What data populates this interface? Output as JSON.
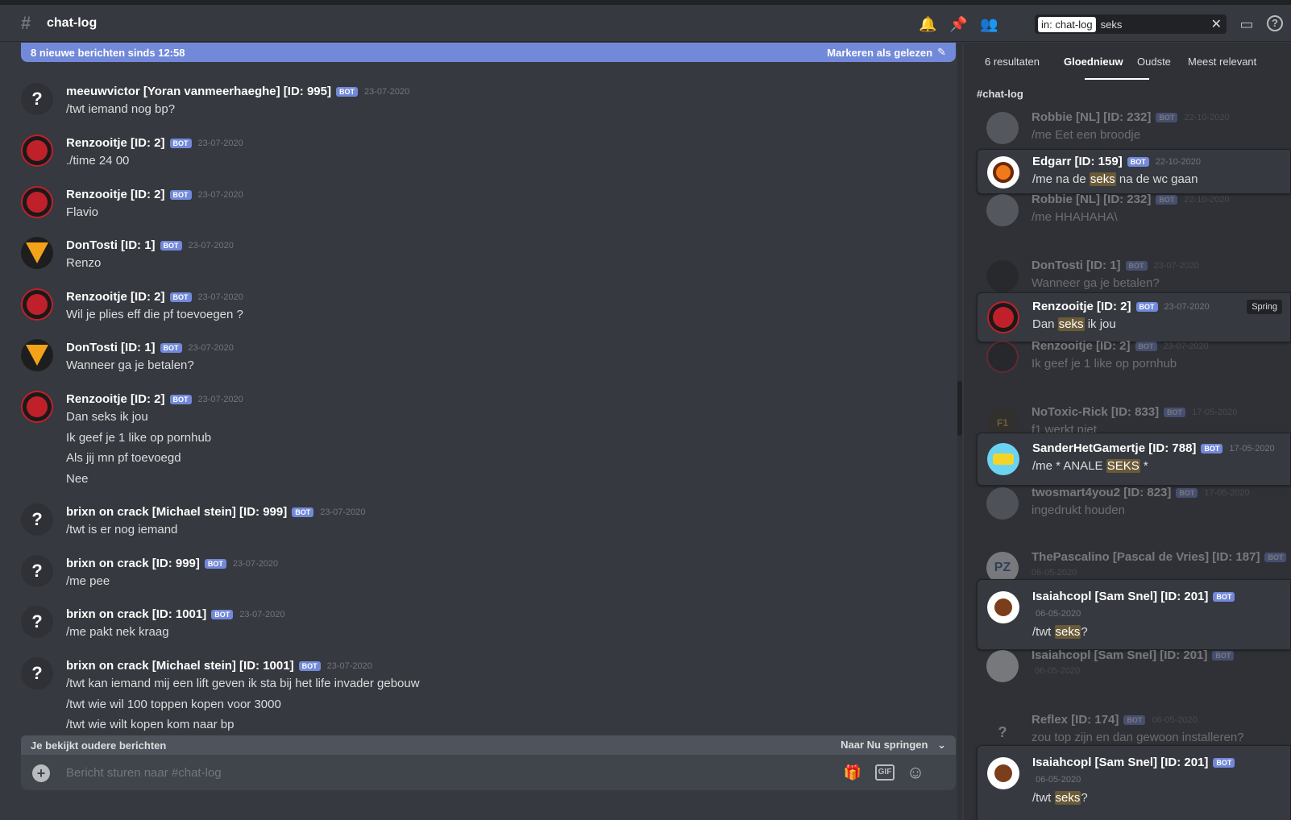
{
  "header": {
    "channel_name": "chat-log",
    "search_filter": "in: chat-log",
    "search_query": "seks"
  },
  "newbar": {
    "text": "8 nieuwe berichten sinds 12:58",
    "mark_read": "Markeren als gelezen"
  },
  "messages": [
    {
      "author": "meeuwvictor [Yoran vanmeerhaeghe] [ID: 995]",
      "badge": "BOT",
      "time": "23-07-2020",
      "lines": [
        "/twt iemand nog bp?"
      ]
    },
    {
      "author": "Renzooitje [ID: 2]",
      "badge": "BOT",
      "time": "23-07-2020",
      "lines": [
        "./time 24 00"
      ]
    },
    {
      "author": "Renzooitje [ID: 2]",
      "badge": "BOT",
      "time": "23-07-2020",
      "lines": [
        "Flavio"
      ]
    },
    {
      "author": "DonTosti [ID: 1]",
      "badge": "BOT",
      "time": "23-07-2020",
      "lines": [
        "Renzo"
      ]
    },
    {
      "author": "Renzooitje [ID: 2]",
      "badge": "BOT",
      "time": "23-07-2020",
      "lines": [
        "Wil je plies eff die pf toevoegen ?"
      ]
    },
    {
      "author": "DonTosti [ID: 1]",
      "badge": "BOT",
      "time": "23-07-2020",
      "lines": [
        "Wanneer ga je betalen?"
      ]
    },
    {
      "author": "Renzooitje [ID: 2]",
      "badge": "BOT",
      "time": "23-07-2020",
      "lines": [
        "Dan seks ik jou",
        "Ik geef je 1 like op pornhub",
        "Als jij mn pf toevoegd",
        "Nee"
      ]
    },
    {
      "author": "brixn on crack [Michael stein] [ID: 999]",
      "badge": "BOT",
      "time": "23-07-2020",
      "lines": [
        "/twt is er nog iemand"
      ]
    },
    {
      "author": "brixn on crack [ID: 999]",
      "badge": "BOT",
      "time": "23-07-2020",
      "lines": [
        "/me pee"
      ]
    },
    {
      "author": "brixn on crack [ID: 1001]",
      "badge": "BOT",
      "time": "23-07-2020",
      "lines": [
        "/me pakt nek kraag"
      ]
    },
    {
      "author": "brixn on crack [Michael stein] [ID: 1001]",
      "badge": "BOT",
      "time": "23-07-2020",
      "lines": [
        "/twt kan iemand mij een lift geven ik sta bij het life invader gebouw",
        "/twt wie wil 100 toppen kopen voor 3000",
        "/twt wie wilt kopen kom naar bp"
      ]
    }
  ],
  "older_bar": {
    "text": "Je bekijkt oudere berichten",
    "jump": "Naar Nu springen"
  },
  "composer": {
    "placeholder": "Bericht sturen naar #chat-log"
  },
  "results": {
    "count": "6 resultaten",
    "tabs": [
      "Gloednieuw",
      "Oudste",
      "Meest relevant"
    ],
    "channel": "#chat-log",
    "jump_label": "Spring",
    "items": [
      {
        "author": "Robbie [NL] [ID: 232]",
        "badge": "BOT",
        "time": "22-10-2020",
        "pre": "/me Eet een broodje",
        "hl": "",
        "post": ""
      },
      {
        "author": "Edgarr [ID: 159]",
        "badge": "BOT",
        "time": "22-10-2020",
        "pre": "/me na de ",
        "hl": "seks",
        "post": " na de wc gaan"
      },
      {
        "author": "Robbie [NL] [ID: 232]",
        "badge": "BOT",
        "time": "22-10-2020",
        "pre": "/me HHAHAHA\\",
        "hl": "",
        "post": ""
      },
      {
        "author": "DonTosti [ID: 1]",
        "badge": "BOT",
        "time": "23-07-2020",
        "pre": "Wanneer ga je betalen?",
        "hl": "",
        "post": ""
      },
      {
        "author": "Renzooitje [ID: 2]",
        "badge": "BOT",
        "time": "23-07-2020",
        "pre": "Dan ",
        "hl": "seks",
        "post": " ik jou"
      },
      {
        "author": "Renzooitje [ID: 2]",
        "badge": "BOT",
        "time": "23-07-2020",
        "pre": "Ik geef je 1 like op pornhub",
        "hl": "",
        "post": ""
      },
      {
        "author": "NoToxic-Rick [ID: 833]",
        "badge": "BOT",
        "time": "17-05-2020",
        "pre": "f1 werkt niet",
        "hl": "",
        "post": ""
      },
      {
        "author": "SanderHetGamertje [ID: 788]",
        "badge": "BOT",
        "time": "17-05-2020",
        "pre": "/me * ANALE ",
        "hl": "SEKS",
        "post": " *"
      },
      {
        "author": "twosmart4you2 [ID: 823]",
        "badge": "BOT",
        "time": "17-05-2020",
        "pre": "ingedrukt houden",
        "hl": "",
        "post": ""
      },
      {
        "author": "ThePascalino [Pascal de Vries] [ID: 187]",
        "badge": "BOT",
        "time": "06-05-2020",
        "pre": "",
        "hl": "",
        "post": ""
      },
      {
        "author": "Isaiahcopl [Sam  Snel] [ID: 201]",
        "badge": "BOT",
        "time": "06-05-2020",
        "pre": "/twt ",
        "hl": "seks",
        "post": "?"
      },
      {
        "author": "Isaiahcopl [Sam  Snel] [ID: 201]",
        "badge": "BOT",
        "time": "06-05-2020",
        "pre": "",
        "hl": "",
        "post": ""
      },
      {
        "author": "Reflex [ID: 174]",
        "badge": "BOT",
        "time": "06-05-2020",
        "pre": "zou top zijn en dan gewoon installeren?",
        "hl": "",
        "post": ""
      },
      {
        "author": "Isaiahcopl [Sam  Snel] [ID: 201]",
        "badge": "BOT",
        "time": "06-05-2020",
        "pre": "/twt ",
        "hl": "seks",
        "post": "?"
      }
    ]
  },
  "icons": {
    "unknown_avatar": "?",
    "pz_avatar": "PZ",
    "notoxic_avatar": "F1",
    "plus": "+",
    "gif": "GIF",
    "clear": "✕",
    "bell": "🔔",
    "pin": "📌",
    "members": "👥",
    "inbox": "▭",
    "help": "?",
    "gift": "🎁",
    "emoji": "☺",
    "mark_read": "✎",
    "chevron": "⌄"
  }
}
